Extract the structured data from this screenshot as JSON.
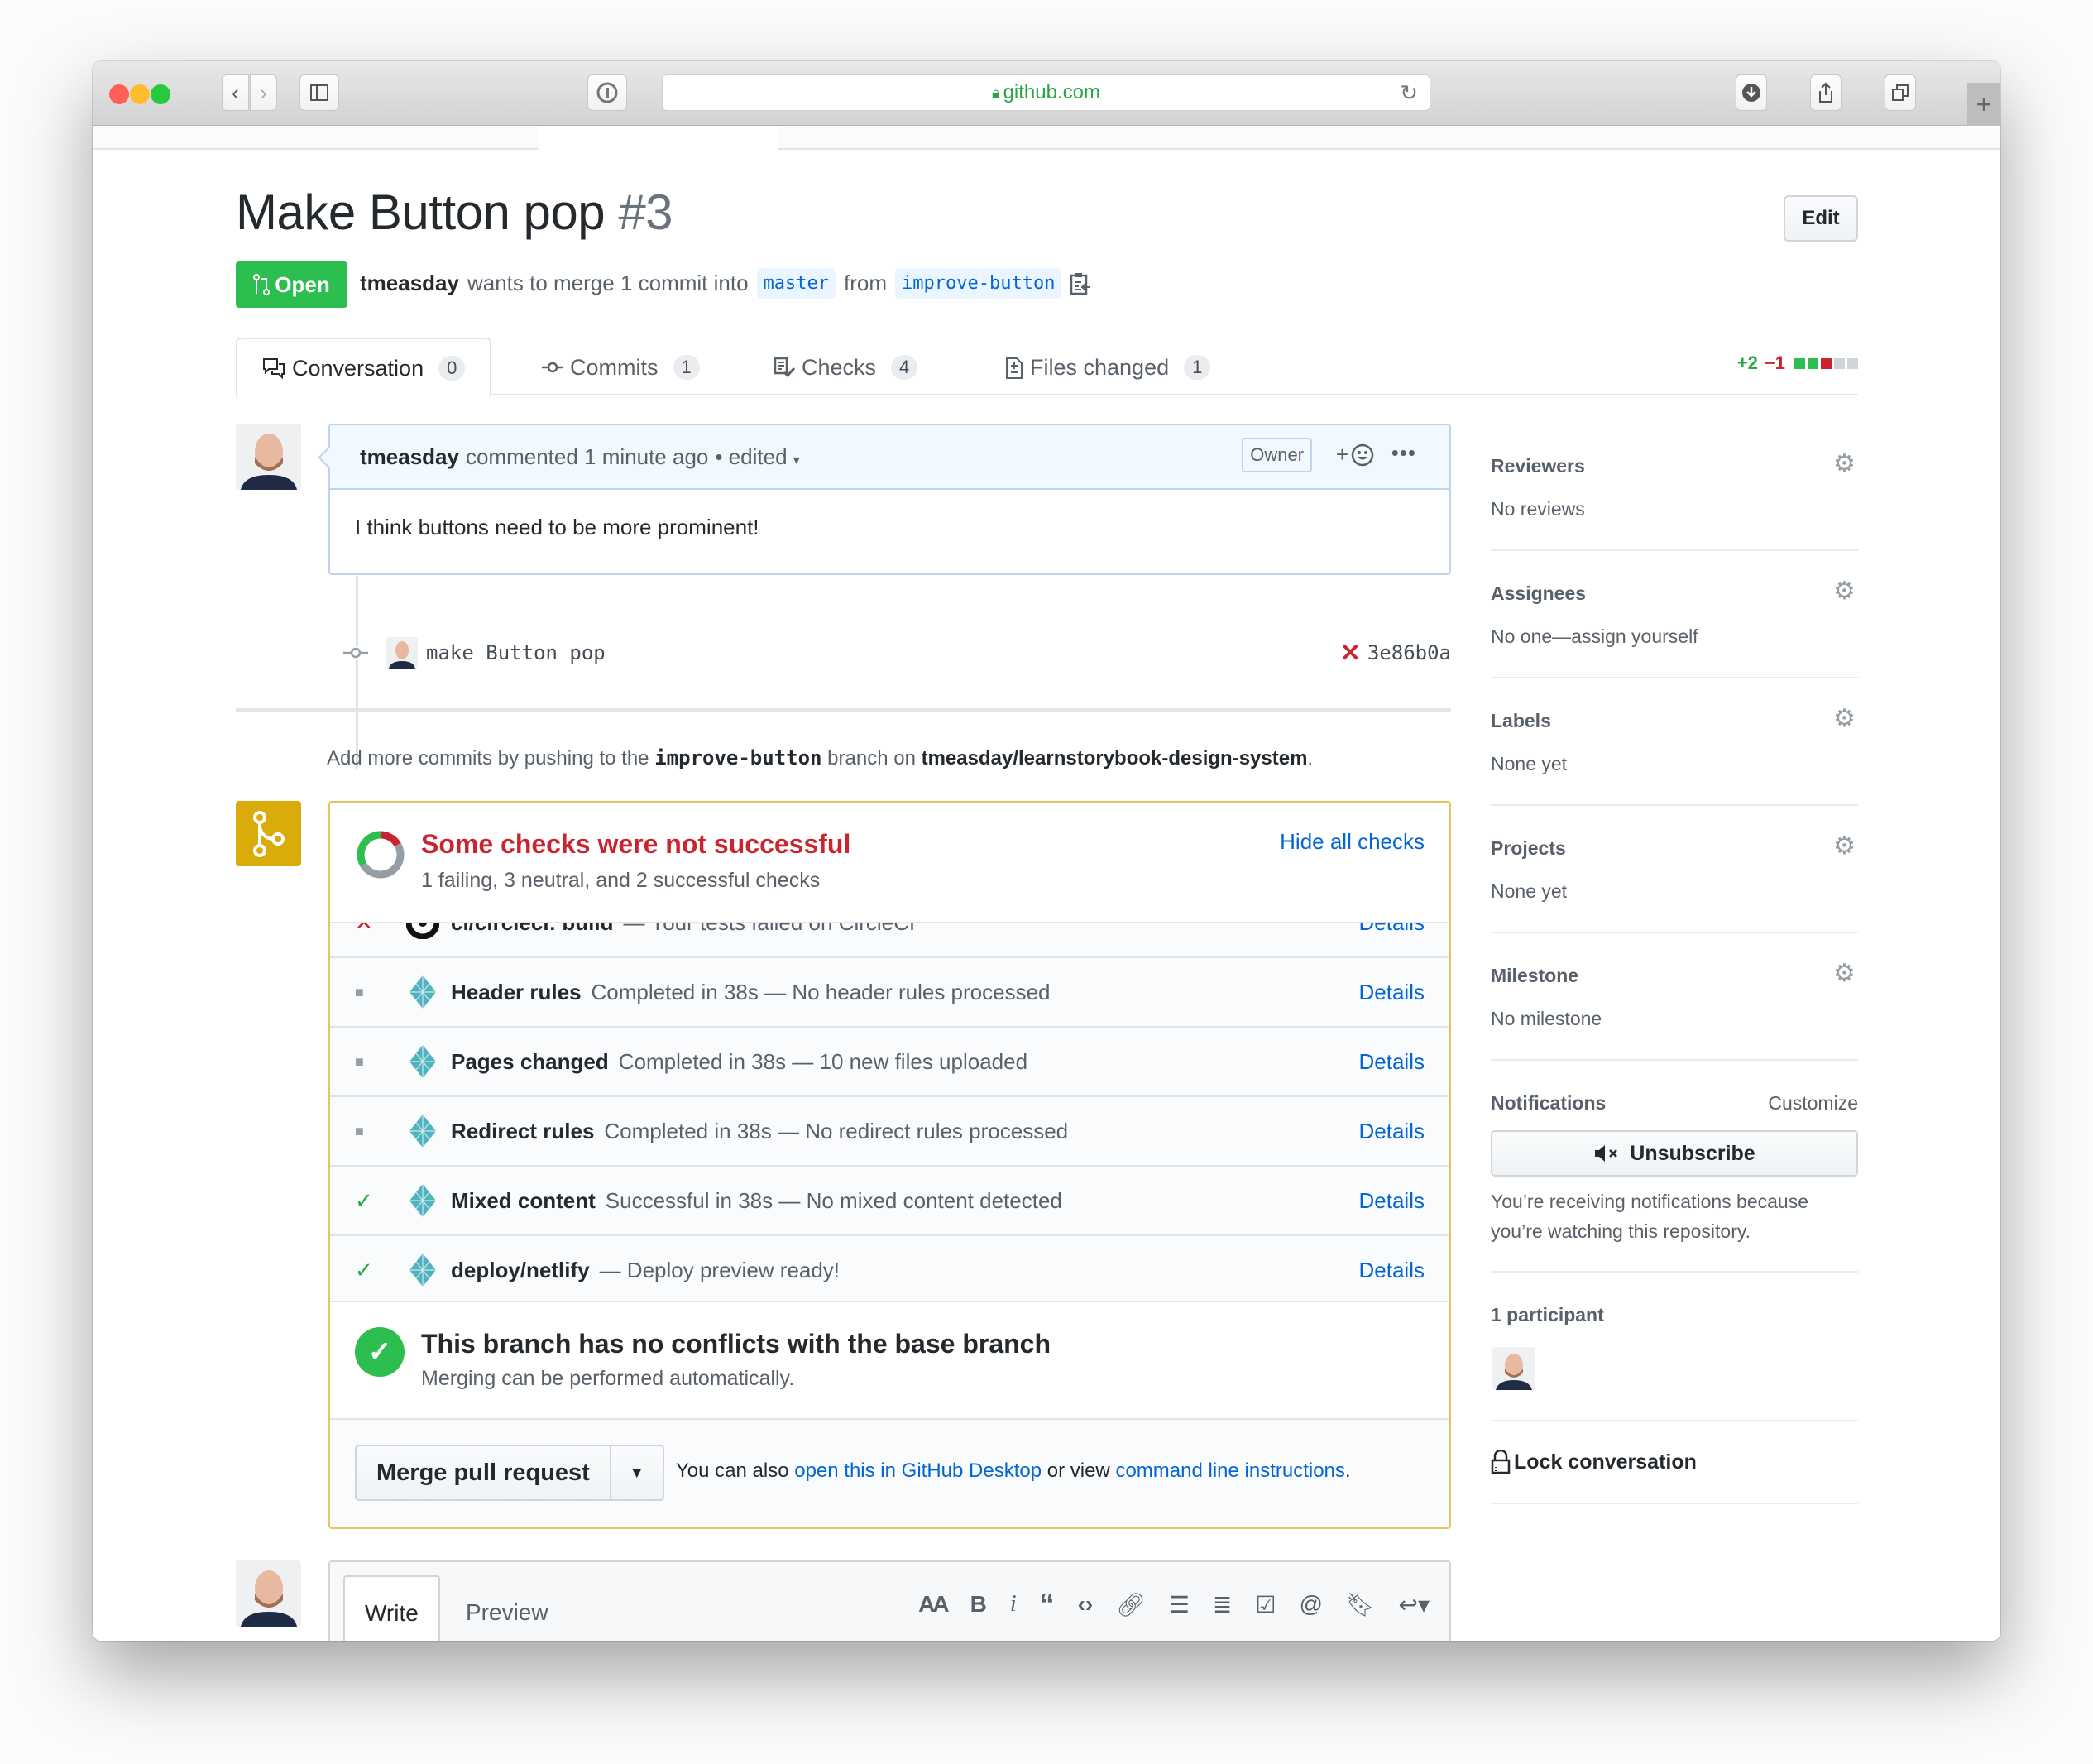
{
  "browser": {
    "url": "github.com",
    "buttons": [
      "back",
      "forward",
      "sidebar",
      "password-manager",
      "downloads",
      "share",
      "tabs",
      "new-tab"
    ]
  },
  "pr": {
    "title": "Make Button pop",
    "number": "#3",
    "edit_label": "Edit",
    "state": "Open",
    "author": "tmeasday",
    "meta_text": "wants to merge 1 commit into",
    "base_branch": "master",
    "from_text": "from",
    "head_branch": "improve-button"
  },
  "tabs": [
    {
      "label": "Conversation",
      "count": "0",
      "selected": true
    },
    {
      "label": "Commits",
      "count": "1"
    },
    {
      "label": "Checks",
      "count": "4"
    },
    {
      "label": "Files changed",
      "count": "1"
    }
  ],
  "diffstat": {
    "additions": "+2",
    "deletions": "−1",
    "blocks": [
      "add",
      "add",
      "del",
      "neutral",
      "neutral"
    ],
    "colors": {
      "add": "#2cbe4e",
      "del": "#cb2431",
      "neutral": "#d1d5da"
    }
  },
  "comment": {
    "author": "tmeasday",
    "action": "commented 1 minute ago",
    "edited": "• edited",
    "badge": "Owner",
    "reaction": "+",
    "body": "I think buttons need to be more prominent!"
  },
  "commit": {
    "message": "make Button pop",
    "sha": "3e86b0a",
    "status": "failed"
  },
  "push_hint": {
    "prefix": "Add more commits by pushing to the",
    "branch": "improve-button",
    "middle": "branch on",
    "repo": "tmeasday/learnstorybook-design-system",
    "suffix": "."
  },
  "checks": {
    "title": "Some checks were not successful",
    "subtitle": "1 failing, 3 neutral, and 2 successful checks",
    "toggle": "Hide all checks",
    "summary": {
      "failing": 1,
      "neutral": 3,
      "successful": 2
    },
    "items": [
      {
        "status": "failure",
        "name": "ci/circleci: build",
        "description": "— Your tests failed on CircleCI",
        "details": "Details",
        "logo": "circleci"
      },
      {
        "status": "neutral",
        "name": "Header rules",
        "description": "Completed in 38s — No header rules processed",
        "details": "Details",
        "logo": "netlify"
      },
      {
        "status": "neutral",
        "name": "Pages changed",
        "description": "Completed in 38s — 10 new files uploaded",
        "details": "Details",
        "logo": "netlify"
      },
      {
        "status": "neutral",
        "name": "Redirect rules",
        "description": "Completed in 38s — No redirect rules processed",
        "details": "Details",
        "logo": "netlify"
      },
      {
        "status": "success",
        "name": "Mixed content",
        "description": "Successful in 38s — No mixed content detected",
        "details": "Details",
        "logo": "netlify"
      },
      {
        "status": "success",
        "name": "deploy/netlify",
        "description": "— Deploy preview ready!",
        "details": "Details",
        "logo": "netlify"
      }
    ]
  },
  "mergeable": {
    "title": "This branch has no conflicts with the base branch",
    "subtitle": "Merging can be performed automatically."
  },
  "merge": {
    "button": "Merge pull request",
    "alt_prefix": "You can also",
    "alt_link1": "open this in GitHub Desktop",
    "alt_middle": "or view",
    "alt_link2": "command line instructions",
    "alt_suffix": "."
  },
  "editor": {
    "tabs": [
      "Write",
      "Preview"
    ],
    "toolbar": [
      "header",
      "bold",
      "italic",
      "quote",
      "code",
      "link",
      "unordered-list",
      "ordered-list",
      "task-list",
      "mention",
      "saved-reply",
      "reply"
    ]
  },
  "sidebar": {
    "sections": [
      {
        "heading": "Reviewers",
        "value": "No reviews"
      },
      {
        "heading": "Assignees",
        "value": "No one—assign yourself"
      },
      {
        "heading": "Labels",
        "value": "None yet"
      },
      {
        "heading": "Projects",
        "value": "None yet"
      },
      {
        "heading": "Milestone",
        "value": "No milestone"
      }
    ],
    "notifications": {
      "heading": "Notifications",
      "customize": "Customize",
      "button": "Unsubscribe",
      "reason": "You’re receiving notifications because you’re watching this repository."
    },
    "participants": {
      "heading": "1 participant"
    },
    "lock": "Lock conversation"
  },
  "colors": {
    "open_green": "#2cbe4e",
    "fail_red": "#cb2431",
    "link_blue": "#0366d6",
    "pending_yellow": "#dbab09"
  }
}
